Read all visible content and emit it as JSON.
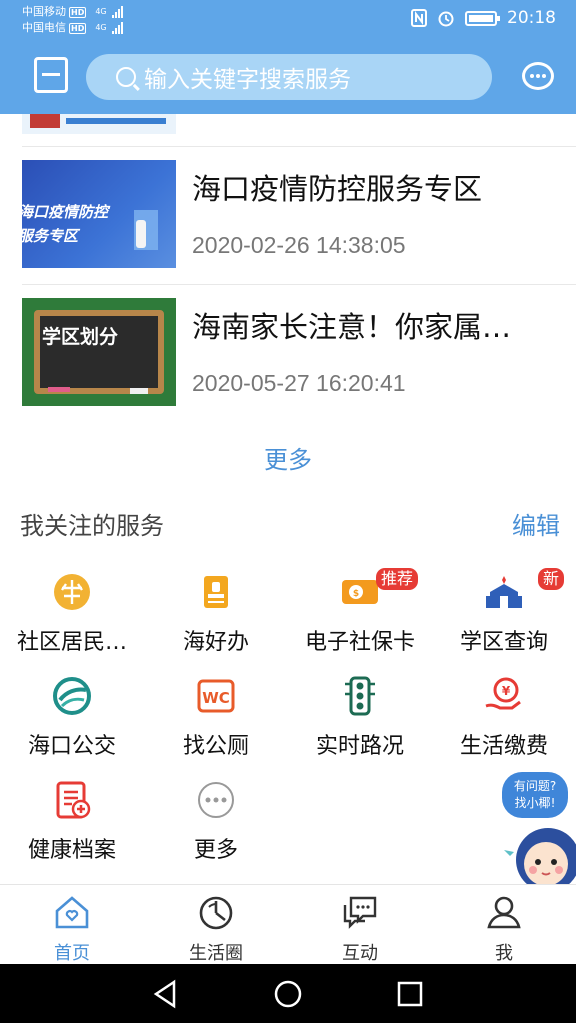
{
  "status_bar": {
    "carrier1": "中国移动",
    "carrier2": "中国电信",
    "hd": "HD",
    "network": "4G",
    "time": "20:18"
  },
  "header": {
    "search_placeholder": "输入关键字搜索服务"
  },
  "news": [
    {
      "title": "海口疫情防控服务专区",
      "time": "2020-02-26 14:38:05",
      "thumb_text": "海口疫情防控\n服务专区"
    },
    {
      "title": "海南家长注意！你家属…",
      "time": "2020-05-27 16:20:41",
      "thumb_text": "学区划分"
    }
  ],
  "more_label": "更多",
  "services": {
    "title": "我关注的服务",
    "edit_label": "编辑",
    "items": [
      {
        "label": "社区居民…",
        "icon": "community-icon"
      },
      {
        "label": "海好办",
        "icon": "stamp-icon"
      },
      {
        "label": "电子社保卡",
        "icon": "social-card-icon",
        "badge": "推荐"
      },
      {
        "label": "学区查询",
        "icon": "school-icon",
        "badge": "新"
      },
      {
        "label": "海口公交",
        "icon": "bus-icon"
      },
      {
        "label": "找公厕",
        "icon": "wc-icon",
        "icon_text": "WC"
      },
      {
        "label": "实时路况",
        "icon": "traffic-light-icon"
      },
      {
        "label": "生活缴费",
        "icon": "payment-icon"
      },
      {
        "label": "健康档案",
        "icon": "health-record-icon"
      },
      {
        "label": "更多",
        "icon": "more-icon"
      }
    ]
  },
  "mascot": {
    "line1": "有问题?",
    "line2": "找小椰!"
  },
  "tabs": [
    {
      "label": "首页",
      "icon": "home-icon",
      "active": true
    },
    {
      "label": "生活圈",
      "icon": "life-circle-icon"
    },
    {
      "label": "互动",
      "icon": "interaction-icon"
    },
    {
      "label": "我",
      "icon": "profile-icon"
    }
  ],
  "colors": {
    "header": "#5fa6e8",
    "accent": "#4a90d6",
    "badge": "#e63b35"
  }
}
